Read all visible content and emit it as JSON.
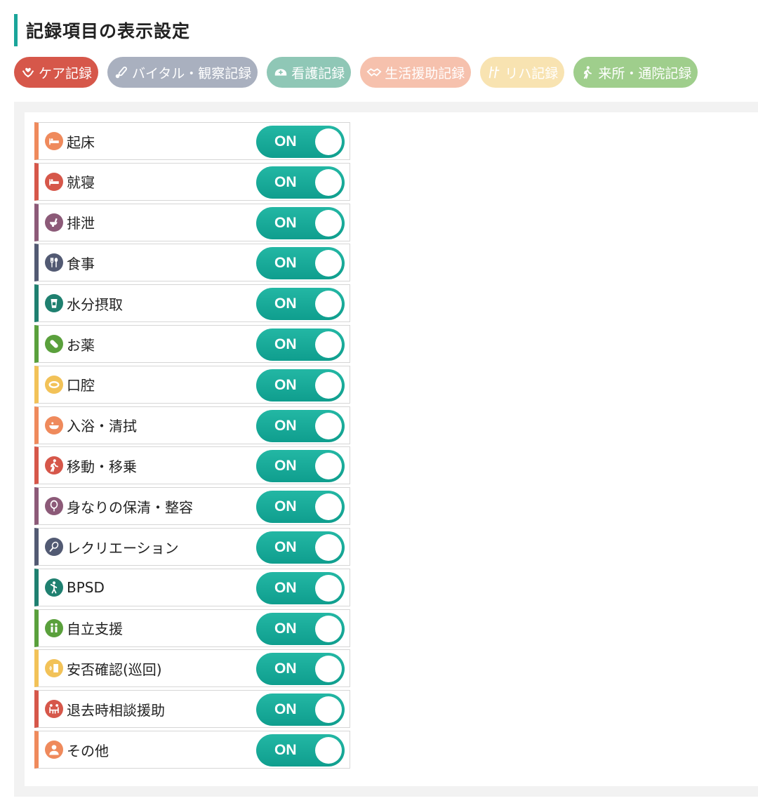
{
  "page": {
    "title": "記録項目の表示設定"
  },
  "tabs": [
    {
      "label": "ケア記録",
      "color": "#d6574a",
      "icon": "care-hands-icon",
      "active": true
    },
    {
      "label": "バイタル・観察記録",
      "color": "#a9b0bf",
      "icon": "thermometer-icon",
      "active": false
    },
    {
      "label": "看護記録",
      "color": "#8fc7b6",
      "icon": "nurse-cap-icon",
      "active": false
    },
    {
      "label": "生活援助記録",
      "color": "#f6c1ad",
      "icon": "handshake-icon",
      "active": false
    },
    {
      "label": "リハ記録",
      "color": "#f8e3b1",
      "icon": "crutch-icon",
      "active": false
    },
    {
      "label": "来所・通院記録",
      "color": "#9fce8c",
      "icon": "walking-person-icon",
      "active": false
    }
  ],
  "items": [
    {
      "label": "起床",
      "color": "#ef8a5c",
      "icon": "bed-icon",
      "toggle": "ON"
    },
    {
      "label": "就寝",
      "color": "#d6574a",
      "icon": "bed-icon",
      "toggle": "ON"
    },
    {
      "label": "排泄",
      "color": "#8c5a78",
      "icon": "toilet-icon",
      "toggle": "ON"
    },
    {
      "label": "食事",
      "color": "#525a73",
      "icon": "fork-spoon-icon",
      "toggle": "ON"
    },
    {
      "label": "水分摂取",
      "color": "#1f8070",
      "icon": "cup-icon",
      "toggle": "ON"
    },
    {
      "label": "お薬",
      "color": "#5aa03c",
      "icon": "pill-icon",
      "toggle": "ON"
    },
    {
      "label": "口腔",
      "color": "#f2c258",
      "icon": "mouth-icon",
      "toggle": "ON"
    },
    {
      "label": "入浴・清拭",
      "color": "#ef8a5c",
      "icon": "bathtub-icon",
      "toggle": "ON"
    },
    {
      "label": "移動・移乗",
      "color": "#d6574a",
      "icon": "walking-person-icon",
      "toggle": "ON"
    },
    {
      "label": "身なりの保清・整容",
      "color": "#8c5a78",
      "icon": "mirror-icon",
      "toggle": "ON"
    },
    {
      "label": "レクリエーション",
      "color": "#525a73",
      "icon": "racket-icon",
      "toggle": "ON"
    },
    {
      "label": "BPSD",
      "color": "#1f8070",
      "icon": "wandering-person-icon",
      "toggle": "ON"
    },
    {
      "label": "自立支援",
      "color": "#5aa03c",
      "icon": "two-people-icon",
      "toggle": "ON"
    },
    {
      "label": "安否確認(巡回)",
      "color": "#f2c258",
      "icon": "door-knock-icon",
      "toggle": "ON"
    },
    {
      "label": "退去時相談援助",
      "color": "#d6574a",
      "icon": "consultation-icon",
      "toggle": "ON"
    },
    {
      "label": "その他",
      "color": "#ef8a5c",
      "icon": "person-icon",
      "toggle": "ON"
    }
  ]
}
